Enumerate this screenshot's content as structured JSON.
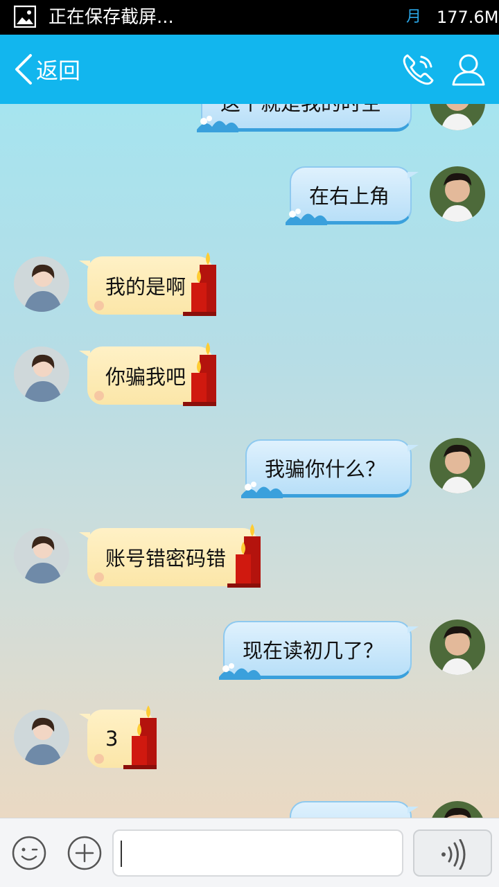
{
  "status_bar": {
    "notification": "正在保存截屏...",
    "moon_char": "月",
    "memory": "177.6M",
    "icon": "image-icon"
  },
  "header": {
    "back_label": "返回",
    "icons": [
      "chevron-left-icon",
      "phone-icon",
      "person-icon"
    ],
    "accent_color": "#12b6ee"
  },
  "messages": [
    {
      "side": "right",
      "text": "这个就是我的时空"
    },
    {
      "side": "right",
      "text": "在右上角"
    },
    {
      "side": "left",
      "text": "我的是啊"
    },
    {
      "side": "left",
      "text": "你骗我吧"
    },
    {
      "side": "right",
      "text": "我骗你什么？"
    },
    {
      "side": "left",
      "text": "账号错密码错"
    },
    {
      "side": "right",
      "text": "现在读初几了？"
    },
    {
      "side": "left",
      "text": "3"
    },
    {
      "side": "right",
      "text": ""
    }
  ],
  "input_bar": {
    "text_value": "",
    "icons": [
      "emoji-icon",
      "plus-icon",
      "voice-icon"
    ]
  },
  "colors": {
    "right_bubble": "#b8dff8",
    "left_bubble": "#fbe6a8",
    "header": "#12b6ee",
    "chat_bg_top": "#a6e4ef",
    "chat_bg_bottom": "#ead9c3"
  }
}
